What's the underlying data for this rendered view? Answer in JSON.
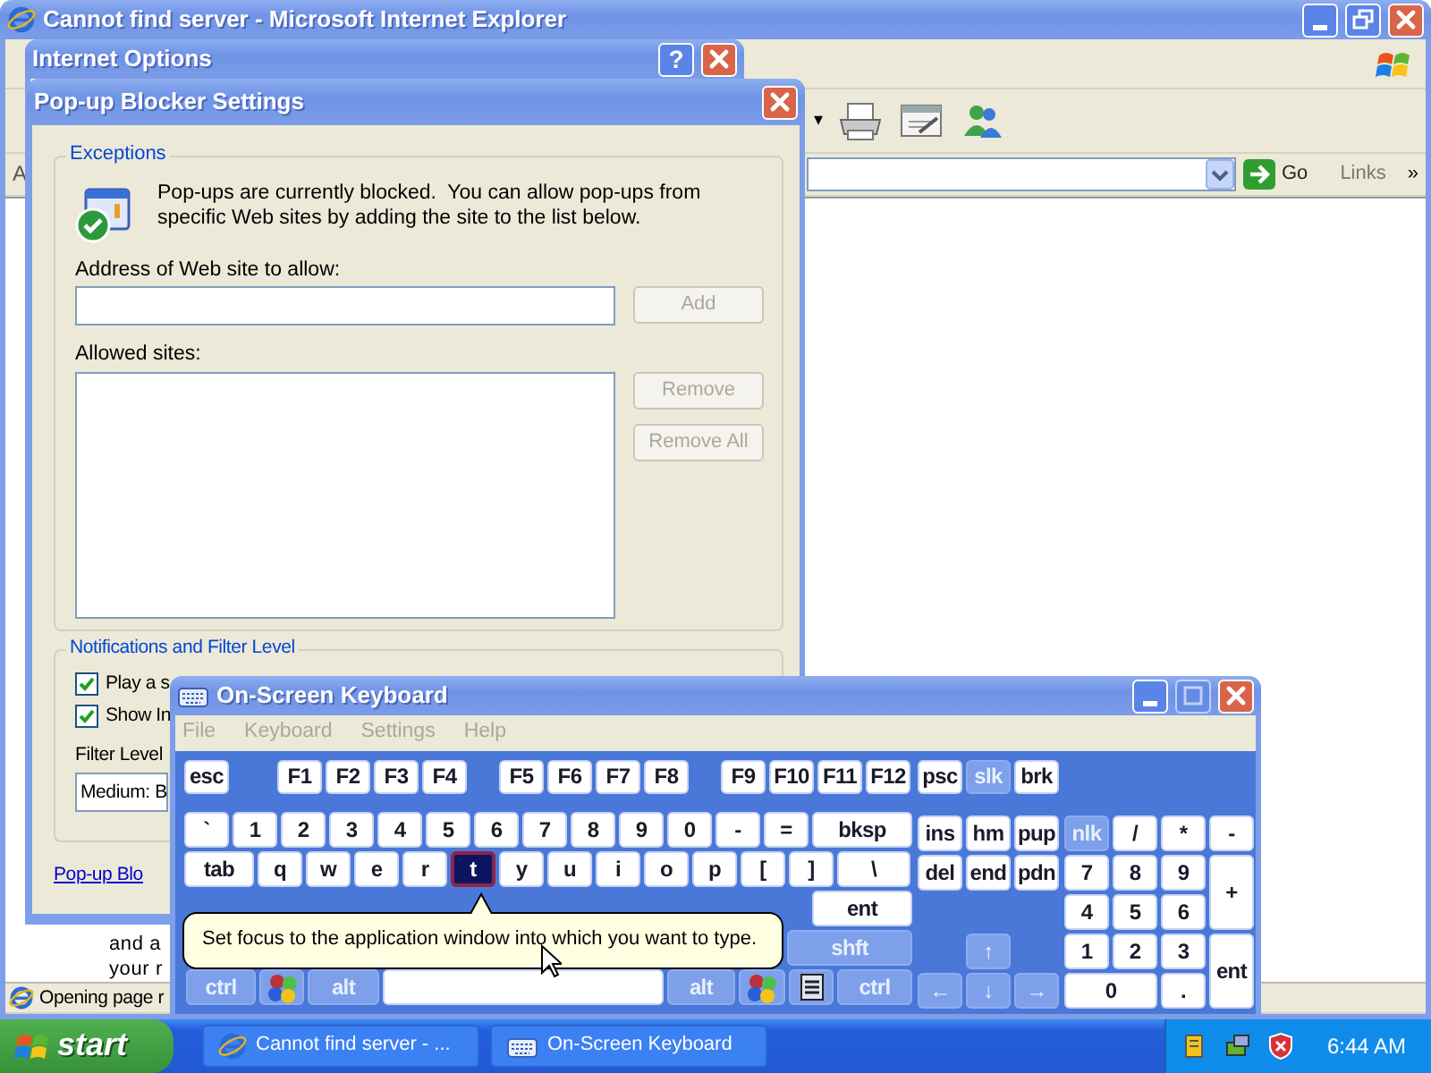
{
  "ie_window": {
    "title": "Cannot find server - Microsoft Internet Explorer",
    "toolbar_dropdown": "▾",
    "address_label": "A",
    "go_button": "Go",
    "links": "Links",
    "chevron": "»",
    "body_lines": [
      "and a",
      "your r"
    ],
    "status_text": "Opening page r"
  },
  "internet_options": {
    "title": "Internet Options",
    "help_button": "?"
  },
  "popup_settings": {
    "title": "Pop-up Blocker Settings",
    "exceptions": {
      "legend": "Exceptions",
      "info": "Pop-ups are currently blocked.  You can allow pop-ups from specific Web sites by adding the site to the list below.",
      "address_label": "Address of Web site to allow:",
      "add_button": {
        "label": "Add",
        "disabled": true
      },
      "allowed_label": "Allowed sites:",
      "buttons": [
        {
          "label": "Remove",
          "disabled": true
        },
        {
          "label": "Remove All",
          "disabled": true
        }
      ]
    },
    "notifications": {
      "legend": "Notifications and Filter Level",
      "checkboxes": [
        {
          "label": "Play a s",
          "checked": true
        },
        {
          "label": "Show In",
          "checked": true
        }
      ],
      "filter_label": "Filter Level",
      "filter_value": "Medium: B"
    },
    "link": "Pop-up Blo"
  },
  "keyboard": {
    "title": "On-Screen Keyboard",
    "menus": [
      {
        "label": "File",
        "disabled": true
      },
      {
        "label": "Keyboard",
        "disabled": true
      },
      {
        "label": "Settings",
        "disabled": true
      },
      {
        "label": "Help",
        "disabled": true
      }
    ],
    "main_rows": [
      [
        {
          "kind": "key",
          "label": "esc",
          "lit": false,
          "pressed": false
        },
        {
          "kind": "key",
          "label": "F1",
          "lit": false,
          "pressed": false
        },
        {
          "kind": "key",
          "label": "F2",
          "lit": false,
          "pressed": false
        },
        {
          "kind": "key",
          "label": "F3",
          "lit": false,
          "pressed": false
        },
        {
          "kind": "key",
          "label": "F4",
          "lit": false,
          "pressed": false
        },
        {
          "kind": "key",
          "label": "F5",
          "lit": false,
          "pressed": false
        },
        {
          "kind": "key",
          "label": "F6",
          "lit": false,
          "pressed": false
        },
        {
          "kind": "key",
          "label": "F7",
          "lit": false,
          "pressed": false
        },
        {
          "kind": "key",
          "label": "F8",
          "lit": false,
          "pressed": false
        },
        {
          "kind": "key",
          "label": "F9",
          "lit": false,
          "pressed": false
        },
        {
          "kind": "key",
          "label": "F10",
          "lit": false,
          "pressed": false
        },
        {
          "kind": "key",
          "label": "F11",
          "lit": false,
          "pressed": false
        },
        {
          "kind": "key",
          "label": "F12",
          "lit": false,
          "pressed": false
        }
      ],
      [
        {
          "kind": "key",
          "label": "`",
          "lit": false,
          "pressed": false
        },
        {
          "kind": "key",
          "label": "1",
          "lit": false,
          "pressed": false
        },
        {
          "kind": "key",
          "label": "2",
          "lit": false,
          "pressed": false
        },
        {
          "kind": "key",
          "label": "3",
          "lit": false,
          "pressed": false
        },
        {
          "kind": "key",
          "label": "4",
          "lit": false,
          "pressed": false
        },
        {
          "kind": "key",
          "label": "5",
          "lit": false,
          "pressed": false
        },
        {
          "kind": "key",
          "label": "6",
          "lit": false,
          "pressed": false
        },
        {
          "kind": "key",
          "label": "7",
          "lit": false,
          "pressed": false
        },
        {
          "kind": "key",
          "label": "8",
          "lit": false,
          "pressed": false
        },
        {
          "kind": "key",
          "label": "9",
          "lit": false,
          "pressed": false
        },
        {
          "kind": "key",
          "label": "0",
          "lit": false,
          "pressed": false
        },
        {
          "kind": "key",
          "label": "-",
          "lit": false,
          "pressed": false
        },
        {
          "kind": "key",
          "label": "=",
          "lit": false,
          "pressed": false
        },
        {
          "kind": "key",
          "label": "bksp",
          "lit": false,
          "pressed": false
        }
      ],
      [
        {
          "kind": "key",
          "label": "tab",
          "lit": false,
          "pressed": false
        },
        {
          "kind": "key",
          "label": "q",
          "lit": false,
          "pressed": false
        },
        {
          "kind": "key",
          "label": "w",
          "lit": false,
          "pressed": false
        },
        {
          "kind": "key",
          "label": "e",
          "lit": false,
          "pressed": false
        },
        {
          "kind": "key",
          "label": "r",
          "lit": false,
          "pressed": false
        },
        {
          "kind": "key",
          "label": "t",
          "lit": false,
          "pressed": true
        },
        {
          "kind": "key",
          "label": "y",
          "lit": false,
          "pressed": false
        },
        {
          "kind": "key",
          "label": "u",
          "lit": false,
          "pressed": false
        },
        {
          "kind": "key",
          "label": "i",
          "lit": false,
          "pressed": false
        },
        {
          "kind": "key",
          "label": "o",
          "lit": false,
          "pressed": false
        },
        {
          "kind": "key",
          "label": "p",
          "lit": false,
          "pressed": false
        },
        {
          "kind": "key",
          "label": "[",
          "lit": false,
          "pressed": false
        },
        {
          "kind": "key",
          "label": "]",
          "lit": false,
          "pressed": false
        },
        {
          "kind": "key",
          "label": "\\",
          "lit": false,
          "pressed": false
        }
      ],
      [
        {
          "kind": "key",
          "label": "ent",
          "lit": false,
          "pressed": false
        }
      ],
      [
        {
          "kind": "key",
          "label": "shft",
          "lit": true,
          "pressed": false
        }
      ],
      [
        {
          "kind": "key",
          "label": "ctrl",
          "lit": true,
          "pressed": false
        },
        {
          "kind": "win",
          "lit": true,
          "pressed": false
        },
        {
          "kind": "key",
          "label": "alt",
          "lit": true,
          "pressed": false
        },
        {
          "kind": "space",
          "lit": false,
          "pressed": false
        },
        {
          "kind": "key",
          "label": "alt",
          "lit": true,
          "pressed": false
        },
        {
          "kind": "win",
          "lit": true,
          "pressed": false
        },
        {
          "kind": "menu",
          "lit": true,
          "pressed": false
        },
        {
          "kind": "key",
          "label": "ctrl",
          "lit": true,
          "pressed": false
        }
      ]
    ],
    "nav_keys": [
      {
        "kind": "key",
        "label": "psc",
        "lit": false,
        "pressed": false
      },
      {
        "kind": "key",
        "label": "slk",
        "lit": true,
        "pressed": false
      },
      {
        "kind": "key",
        "label": "brk",
        "lit": false,
        "pressed": false
      },
      {
        "kind": "key",
        "label": "ins",
        "lit": false,
        "pressed": false
      },
      {
        "kind": "key",
        "label": "hm",
        "lit": false,
        "pressed": false
      },
      {
        "kind": "key",
        "label": "pup",
        "lit": false,
        "pressed": false
      },
      {
        "kind": "key",
        "label": "del",
        "lit": false,
        "pressed": false
      },
      {
        "kind": "key",
        "label": "end",
        "lit": false,
        "pressed": false
      },
      {
        "kind": "key",
        "label": "pdn",
        "lit": false,
        "pressed": false
      },
      {
        "kind": "key",
        "label": "↑",
        "lit": true,
        "pressed": false
      },
      {
        "kind": "key",
        "label": "←",
        "lit": true,
        "pressed": false
      },
      {
        "kind": "key",
        "label": "↓",
        "lit": true,
        "pressed": false
      },
      {
        "kind": "key",
        "label": "→",
        "lit": true,
        "pressed": false
      }
    ],
    "numpad_keys": [
      {
        "kind": "key",
        "label": "nlk",
        "lit": true,
        "pressed": false
      },
      {
        "kind": "key",
        "label": "/",
        "lit": false,
        "pressed": false
      },
      {
        "kind": "key",
        "label": "*",
        "lit": false,
        "pressed": false
      },
      {
        "kind": "key",
        "label": "-",
        "lit": false,
        "pressed": false
      },
      {
        "kind": "key",
        "label": "7",
        "lit": false,
        "pressed": false
      },
      {
        "kind": "key",
        "label": "8",
        "lit": false,
        "pressed": false
      },
      {
        "kind": "key",
        "label": "9",
        "lit": false,
        "pressed": false
      },
      {
        "kind": "key",
        "label": "+",
        "lit": false,
        "pressed": false
      },
      {
        "kind": "key",
        "label": "4",
        "lit": false,
        "pressed": false
      },
      {
        "kind": "key",
        "label": "5",
        "lit": false,
        "pressed": false
      },
      {
        "kind": "key",
        "label": "6",
        "lit": false,
        "pressed": false
      },
      {
        "kind": "key",
        "label": "1",
        "lit": false,
        "pressed": false
      },
      {
        "kind": "key",
        "label": "2",
        "lit": false,
        "pressed": false
      },
      {
        "kind": "key",
        "label": "3",
        "lit": false,
        "pressed": false
      },
      {
        "kind": "key",
        "label": "ent",
        "lit": false,
        "pressed": false
      },
      {
        "kind": "key",
        "label": "0",
        "lit": false,
        "pressed": false
      },
      {
        "kind": "key",
        "label": ".",
        "lit": false,
        "pressed": false
      }
    ]
  },
  "tooltip": "Set focus to the application window into which you want to type.",
  "taskbar": {
    "start": "start",
    "tasks": [
      {
        "kind": "browser",
        "label": "Cannot find server - ...",
        "selected": false
      },
      {
        "kind": "keyboard",
        "label": "On-Screen Keyboard",
        "selected": false
      }
    ],
    "clock": "6:44 AM"
  }
}
